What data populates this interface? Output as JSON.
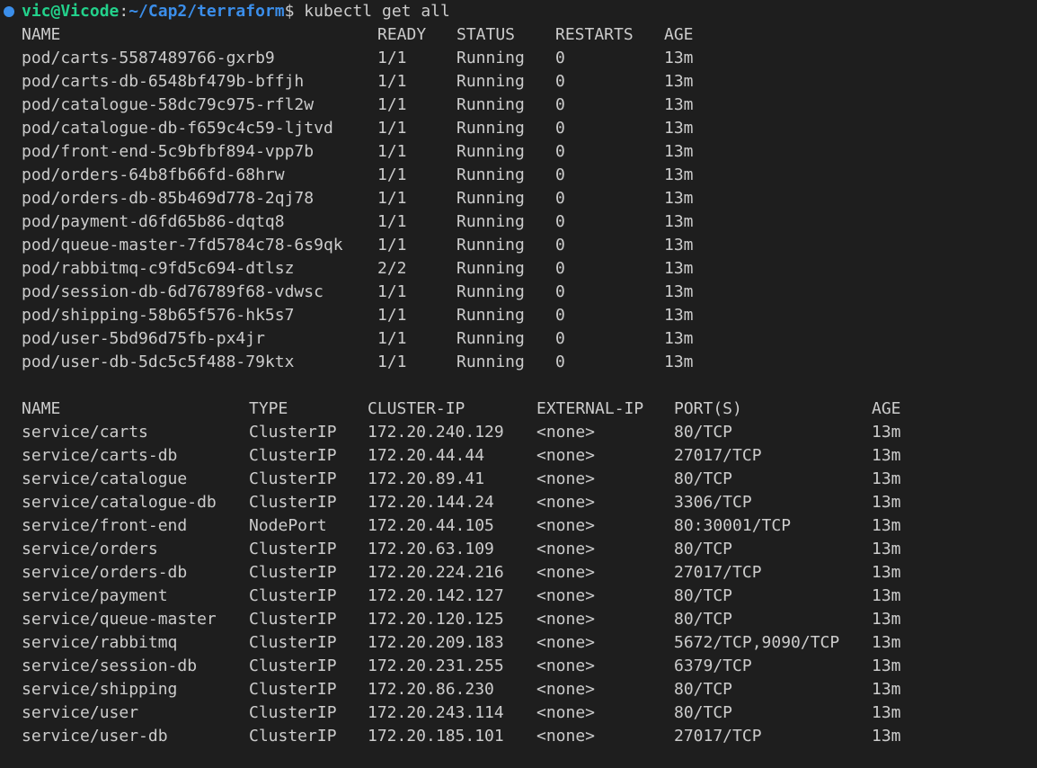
{
  "prompt": {
    "user_host": "vic@Vicode",
    "colon": ":",
    "path": "~/Cap2/terraform",
    "dollar": "$",
    "command": " kubectl get all"
  },
  "pods": {
    "headers": [
      "NAME",
      "READY",
      "STATUS",
      "RESTARTS",
      "AGE"
    ],
    "rows": [
      [
        "pod/carts-5587489766-gxrb9",
        "1/1",
        "Running",
        "0",
        "13m"
      ],
      [
        "pod/carts-db-6548bf479b-bffjh",
        "1/1",
        "Running",
        "0",
        "13m"
      ],
      [
        "pod/catalogue-58dc79c975-rfl2w",
        "1/1",
        "Running",
        "0",
        "13m"
      ],
      [
        "pod/catalogue-db-f659c4c59-ljtvd",
        "1/1",
        "Running",
        "0",
        "13m"
      ],
      [
        "pod/front-end-5c9bfbf894-vpp7b",
        "1/1",
        "Running",
        "0",
        "13m"
      ],
      [
        "pod/orders-64b8fb66fd-68hrw",
        "1/1",
        "Running",
        "0",
        "13m"
      ],
      [
        "pod/orders-db-85b469d778-2qj78",
        "1/1",
        "Running",
        "0",
        "13m"
      ],
      [
        "pod/payment-d6fd65b86-dqtq8",
        "1/1",
        "Running",
        "0",
        "13m"
      ],
      [
        "pod/queue-master-7fd5784c78-6s9qk",
        "1/1",
        "Running",
        "0",
        "13m"
      ],
      [
        "pod/rabbitmq-c9fd5c694-dtlsz",
        "2/2",
        "Running",
        "0",
        "13m"
      ],
      [
        "pod/session-db-6d76789f68-vdwsc",
        "1/1",
        "Running",
        "0",
        "13m"
      ],
      [
        "pod/shipping-58b65f576-hk5s7",
        "1/1",
        "Running",
        "0",
        "13m"
      ],
      [
        "pod/user-5bd96d75fb-px4jr",
        "1/1",
        "Running",
        "0",
        "13m"
      ],
      [
        "pod/user-db-5dc5c5f488-79ktx",
        "1/1",
        "Running",
        "0",
        "13m"
      ]
    ]
  },
  "services": {
    "headers": [
      "NAME",
      "TYPE",
      "CLUSTER-IP",
      "EXTERNAL-IP",
      "PORT(S)",
      "AGE"
    ],
    "rows": [
      [
        "service/carts",
        "ClusterIP",
        "172.20.240.129",
        "<none>",
        "80/TCP",
        "13m"
      ],
      [
        "service/carts-db",
        "ClusterIP",
        "172.20.44.44",
        "<none>",
        "27017/TCP",
        "13m"
      ],
      [
        "service/catalogue",
        "ClusterIP",
        "172.20.89.41",
        "<none>",
        "80/TCP",
        "13m"
      ],
      [
        "service/catalogue-db",
        "ClusterIP",
        "172.20.144.24",
        "<none>",
        "3306/TCP",
        "13m"
      ],
      [
        "service/front-end",
        "NodePort",
        "172.20.44.105",
        "<none>",
        "80:30001/TCP",
        "13m"
      ],
      [
        "service/orders",
        "ClusterIP",
        "172.20.63.109",
        "<none>",
        "80/TCP",
        "13m"
      ],
      [
        "service/orders-db",
        "ClusterIP",
        "172.20.224.216",
        "<none>",
        "27017/TCP",
        "13m"
      ],
      [
        "service/payment",
        "ClusterIP",
        "172.20.142.127",
        "<none>",
        "80/TCP",
        "13m"
      ],
      [
        "service/queue-master",
        "ClusterIP",
        "172.20.120.125",
        "<none>",
        "80/TCP",
        "13m"
      ],
      [
        "service/rabbitmq",
        "ClusterIP",
        "172.20.209.183",
        "<none>",
        "5672/TCP,9090/TCP",
        "13m"
      ],
      [
        "service/session-db",
        "ClusterIP",
        "172.20.231.255",
        "<none>",
        "6379/TCP",
        "13m"
      ],
      [
        "service/shipping",
        "ClusterIP",
        "172.20.86.230",
        "<none>",
        "80/TCP",
        "13m"
      ],
      [
        "service/user",
        "ClusterIP",
        "172.20.243.114",
        "<none>",
        "80/TCP",
        "13m"
      ],
      [
        "service/user-db",
        "ClusterIP",
        "172.20.185.101",
        "<none>",
        "27017/TCP",
        "13m"
      ]
    ]
  }
}
